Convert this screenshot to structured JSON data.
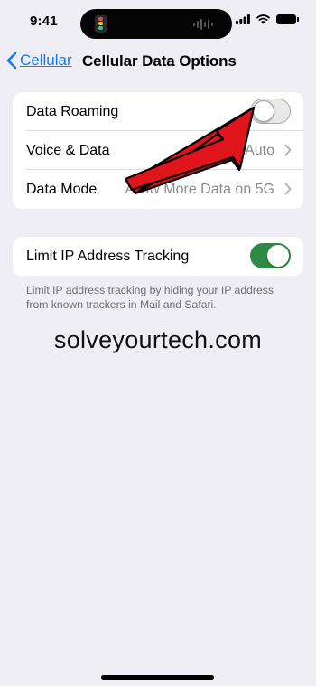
{
  "status_bar": {
    "time": "9:41",
    "icons": [
      "cellular-signal-icon",
      "wifi-icon",
      "battery-icon"
    ]
  },
  "nav": {
    "back_label": "Cellular",
    "title": "Cellular Data Options"
  },
  "group1": {
    "rows": [
      {
        "label": "Data Roaming",
        "control": "toggle",
        "toggle_on": false
      },
      {
        "label": "Voice & Data",
        "value": "5G Auto",
        "control": "chevron"
      },
      {
        "label": "Data Mode",
        "value": "Allow More Data on 5G",
        "control": "chevron"
      }
    ]
  },
  "group2": {
    "rows": [
      {
        "label": "Limit IP Address Tracking",
        "control": "toggle",
        "toggle_on": true
      }
    ],
    "footnote": "Limit IP address tracking by hiding your IP address from known trackers in Mail and Safari."
  },
  "watermark": "solveyourtech.com",
  "colors": {
    "accent": "#0a7bff",
    "toggle_on": "#2e8b45",
    "annotation_arrow": "#e0141b",
    "background": "#efeef4"
  }
}
